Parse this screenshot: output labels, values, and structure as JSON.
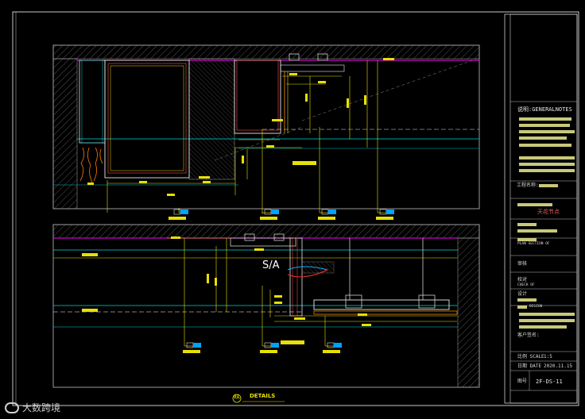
{
  "title_block": {
    "notes_title": "说明:GENERALNOTES",
    "project_label": "工程名称:",
    "drawing_name": "天花节点",
    "plan_section_label": "PLAN SECTION OF",
    "review_label": "审核",
    "check_label": "校对",
    "check_sub": "CHECK OF",
    "design_label": "设计",
    "design_code": "DESIGN",
    "client_label": "客户签名:",
    "scale_label": "比例 SCALE",
    "scale_value": "1:5",
    "date_label": "日期 DATE",
    "date_value": "2020.11.15",
    "drawing_no_label": "图号",
    "drawing_no_value": "2F-DS-11"
  },
  "drawing": {
    "caption_title": "DETAILS",
    "caption_number": "01",
    "section_symbol": "S/A"
  },
  "watermark": {
    "text": "大数跨境"
  }
}
